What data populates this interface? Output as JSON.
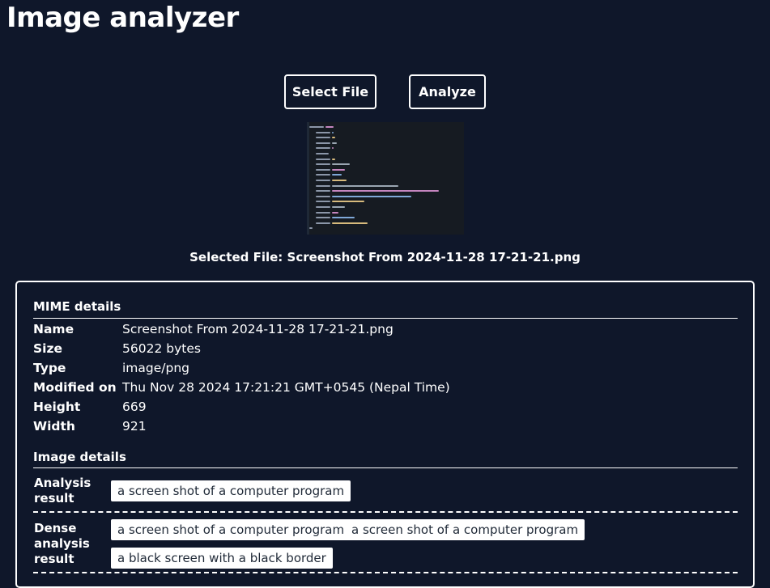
{
  "app": {
    "title": "Image analyzer"
  },
  "toolbar": {
    "select_label": "Select File",
    "analyze_label": "Analyze"
  },
  "selected_file": "Selected File: Screenshot From 2024-11-28 17-21-21.png",
  "mime": {
    "heading": "MIME details",
    "rows": [
      {
        "key": "Name",
        "value": "Screenshot From 2024-11-28 17-21-21.png"
      },
      {
        "key": "Size",
        "value": "56022 bytes"
      },
      {
        "key": "Type",
        "value": "image/png"
      },
      {
        "key": "Modified on",
        "value": "Thu Nov 28 2024 17:21:21 GMT+0545 (Nepal Time)"
      },
      {
        "key": "Height",
        "value": "669"
      },
      {
        "key": "Width",
        "value": "921"
      }
    ]
  },
  "image": {
    "heading": "Image details",
    "analysis_label": "Analysis result",
    "analysis_chips": [
      "a screen shot of a computer program"
    ],
    "dense_label": "Dense analysis result",
    "dense_chips": [
      "a screen shot of a computer program",
      "a screen shot of a computer program",
      "a black screen with a black border"
    ]
  },
  "colors": {
    "background": "#0f172a",
    "foreground": "#ffffff",
    "chip_text": "#1f2937"
  }
}
